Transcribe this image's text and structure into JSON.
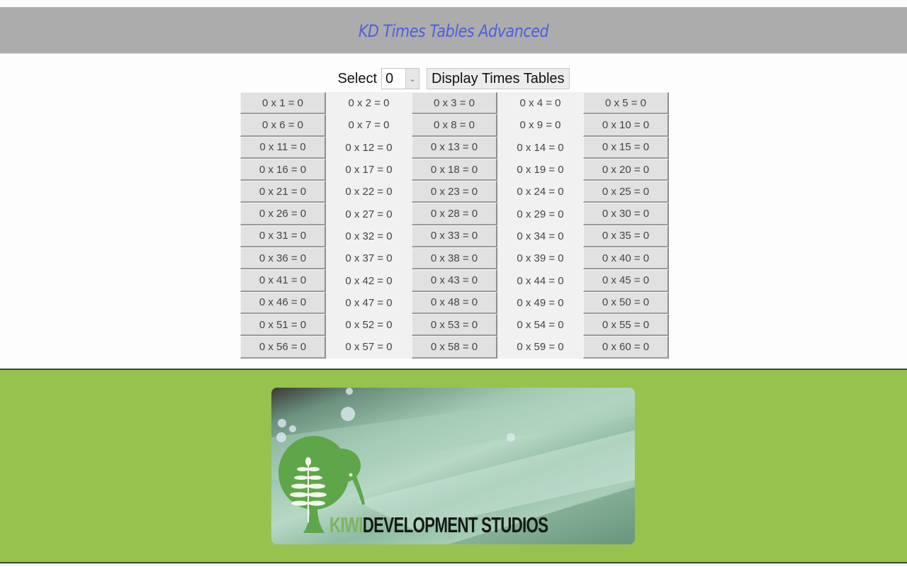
{
  "header": {
    "title": "KD Times Tables Advanced"
  },
  "controls": {
    "select_label": "Select",
    "select_value": "0",
    "select_arrow_icon": "chevron-down-icon",
    "display_button_label": "Display Times Tables"
  },
  "grid": {
    "cells": [
      "0 x 1 = 0",
      "0 x 2 = 0",
      "0 x 3 = 0",
      "0 x 4 = 0",
      "0 x 5 = 0",
      "0 x 6 = 0",
      "0 x 7 = 0",
      "0 x 8 = 0",
      "0 x 9 = 0",
      "0 x 10 = 0",
      "0 x 11 = 0",
      "0 x 12 = 0",
      "0 x 13 = 0",
      "0 x 14 = 0",
      "0 x 15 = 0",
      "0 x 16 = 0",
      "0 x 17 = 0",
      "0 x 18 = 0",
      "0 x 19 = 0",
      "0 x 20 = 0",
      "0 x 21 = 0",
      "0 x 22 = 0",
      "0 x 23 = 0",
      "0 x 24 = 0",
      "0 x 25 = 0",
      "0 x 26 = 0",
      "0 x 27 = 0",
      "0 x 28 = 0",
      "0 x 29 = 0",
      "0 x 30 = 0",
      "0 x 31 = 0",
      "0 x 32 = 0",
      "0 x 33 = 0",
      "0 x 34 = 0",
      "0 x 35 = 0",
      "0 x 36 = 0",
      "0 x 37 = 0",
      "0 x 38 = 0",
      "0 x 39 = 0",
      "0 x 40 = 0",
      "0 x 41 = 0",
      "0 x 42 = 0",
      "0 x 43 = 0",
      "0 x 44 = 0",
      "0 x 45 = 0",
      "0 x 46 = 0",
      "0 x 47 = 0",
      "0 x 48 = 0",
      "0 x 49 = 0",
      "0 x 50 = 0",
      "0 x 51 = 0",
      "0 x 52 = 0",
      "0 x 53 = 0",
      "0 x 54 = 0",
      "0 x 55 = 0",
      "0 x 56 = 0",
      "0 x 57 = 0",
      "0 x 58 = 0",
      "0 x 59 = 0",
      "0 x 60 = 0"
    ]
  },
  "footer": {
    "logo": {
      "icon": "kiwi-fern-icon",
      "text_highlight": "KIWI",
      "text_rest": "DEVELOPMENT STUDIOS"
    }
  },
  "colors": {
    "header_bg": "#acacac",
    "title": "#4d5fdf",
    "footer_bg": "#97c24e"
  }
}
